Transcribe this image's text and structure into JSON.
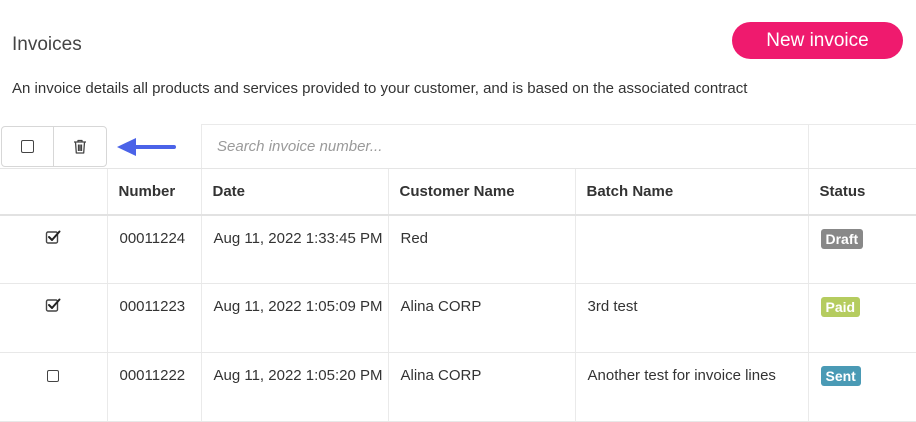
{
  "header": {
    "title": "Invoices",
    "new_button_label": "New invoice",
    "description": "An invoice details all products and services provided to your customer, and is based on the associated contract"
  },
  "toolbar": {
    "select_all_icon": "checkbox-empty-icon",
    "delete_icon": "trash-icon",
    "search_placeholder": "Search invoice number...",
    "arrow_color": "#4b63e8"
  },
  "table": {
    "columns": [
      "",
      "Number",
      "Date",
      "Customer Name",
      "Batch Name",
      "Status"
    ],
    "rows": [
      {
        "checked": true,
        "number": "00011224",
        "date": "Aug 11, 2022 1:33:45 PM",
        "customer": "Red",
        "batch": "",
        "status": "Draft",
        "status_color": "#888888"
      },
      {
        "checked": true,
        "number": "00011223",
        "date": "Aug 11, 2022 1:05:09 PM",
        "customer": "Alina CORP",
        "batch": "3rd test",
        "status": "Paid",
        "status_color": "#b5cc5f"
      },
      {
        "checked": false,
        "number": "00011222",
        "date": "Aug 11, 2022 1:05:20 PM",
        "customer": "Alina CORP",
        "batch": "Another test for invoice lines",
        "status": "Sent",
        "status_color": "#4a9ab5"
      }
    ]
  },
  "colors": {
    "brand": "#ef1a6e",
    "link": "#3b7ab5"
  }
}
